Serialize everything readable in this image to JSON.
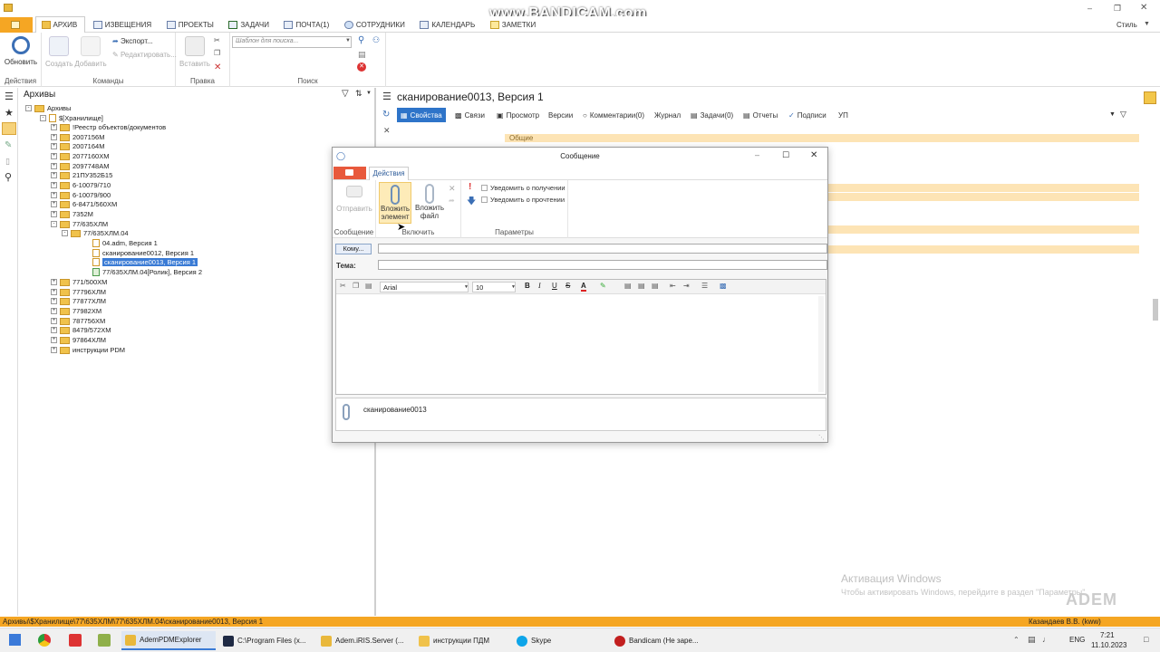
{
  "watermark": "www.BANDICAM.com",
  "top_right": {
    "style_label": "Стиль"
  },
  "tabs": [
    {
      "label": "АРХИВ"
    },
    {
      "label": "ИЗВЕЩЕНИЯ"
    },
    {
      "label": "ПРОЕКТЫ"
    },
    {
      "label": "ЗАДАЧИ"
    },
    {
      "label": "ПОЧТА(1)"
    },
    {
      "label": "СОТРУДНИКИ"
    },
    {
      "label": "КАЛЕНДАРЬ"
    },
    {
      "label": "ЗАМЕТКИ"
    }
  ],
  "ribbon": {
    "refresh": "Обновить",
    "actions_group": "Действия",
    "create": "Создать",
    "add": "Добавить",
    "export": "Экспорт...",
    "edit": "Редактировать...",
    "commands_group": "Команды",
    "paste": "Вставить",
    "edit_group": "Правка",
    "search_placeholder": "Шаблон для поиска...",
    "search_group": "Поиск"
  },
  "left": {
    "header": "Архивы",
    "tree": [
      {
        "label": "Архивы"
      },
      {
        "label": "$[Хранилище]"
      },
      {
        "label": "!Реестр объектов/документов"
      },
      {
        "label": "2007156М"
      },
      {
        "label": "2007164М"
      },
      {
        "label": "2077160ХМ"
      },
      {
        "label": "2097748АМ"
      },
      {
        "label": "21ПУ352Б15"
      },
      {
        "label": "6-10079/710"
      },
      {
        "label": "6-10079/900"
      },
      {
        "label": "6-8471/560ХМ"
      },
      {
        "label": "7352М"
      },
      {
        "label": "77/635ХЛМ"
      },
      {
        "label": "77/635ХЛМ.04"
      },
      {
        "label": "04.adm, Версия 1"
      },
      {
        "label": "сканирование0012, Версия 1"
      },
      {
        "label": "сканирование0013, Версия 1"
      },
      {
        "label": "77/635ХЛМ.04[Ролик], Версия 2"
      },
      {
        "label": "771/500ХМ"
      },
      {
        "label": "77796ХЛМ"
      },
      {
        "label": "77877ХЛМ"
      },
      {
        "label": "77982ХМ"
      },
      {
        "label": "787756ХМ"
      },
      {
        "label": "8479/572ХМ"
      },
      {
        "label": "97864ХЛМ"
      },
      {
        "label": "инструкции PDM"
      }
    ]
  },
  "right": {
    "title": "сканирование0013, Версия 1",
    "tabs": [
      {
        "label": "Свойства"
      },
      {
        "label": "Связи"
      },
      {
        "label": "Просмотр"
      },
      {
        "label": "Версии"
      },
      {
        "label": "Комментарии(0)"
      },
      {
        "label": "Журнал"
      },
      {
        "label": "Задачи(0)"
      },
      {
        "label": "Отчеты"
      },
      {
        "label": "Подписи"
      },
      {
        "label": "УП"
      }
    ],
    "general": "Общие"
  },
  "dialog": {
    "title": "Сообщение",
    "tab": "Действия",
    "send": "Отправить",
    "message_group": "Сообщение",
    "attach_item_1": "Вложить",
    "attach_item_2": "элемент",
    "attach_file_1": "Вложить",
    "attach_file_2": "файл",
    "include_group": "Включить",
    "notify_receive": "Уведомить о получении",
    "notify_read": "Уведомить о прочтении",
    "params_group": "Параметры",
    "to_button": "Кому...",
    "subject_label": "Тема:",
    "font": "Arial",
    "font_size": "10",
    "attachment": "сканирование0013"
  },
  "status": {
    "path": "Архивы\\$Хранилище\\77\\635ХЛМ\\77\\635ХЛМ.04\\сканирование0013, Версия 1",
    "user": "Казандаев В.В. (kww)"
  },
  "activation": {
    "title": "Активация Windows",
    "text": "Чтобы активировать Windows, перейдите в раздел \"Параметры\".",
    "logo": "ADEM"
  },
  "taskbar": {
    "items": [
      {
        "label": "AdemPDMExplorer"
      },
      {
        "label": "C:\\Program Files (x..."
      },
      {
        "label": "Adem.iRIS.Server (..."
      },
      {
        "label": "инструкции ПДМ"
      },
      {
        "label": "Skype"
      },
      {
        "label": "Bandicam (Не заре..."
      }
    ],
    "lang": "ENG",
    "time": "7:21",
    "date": "11.10.2023"
  }
}
